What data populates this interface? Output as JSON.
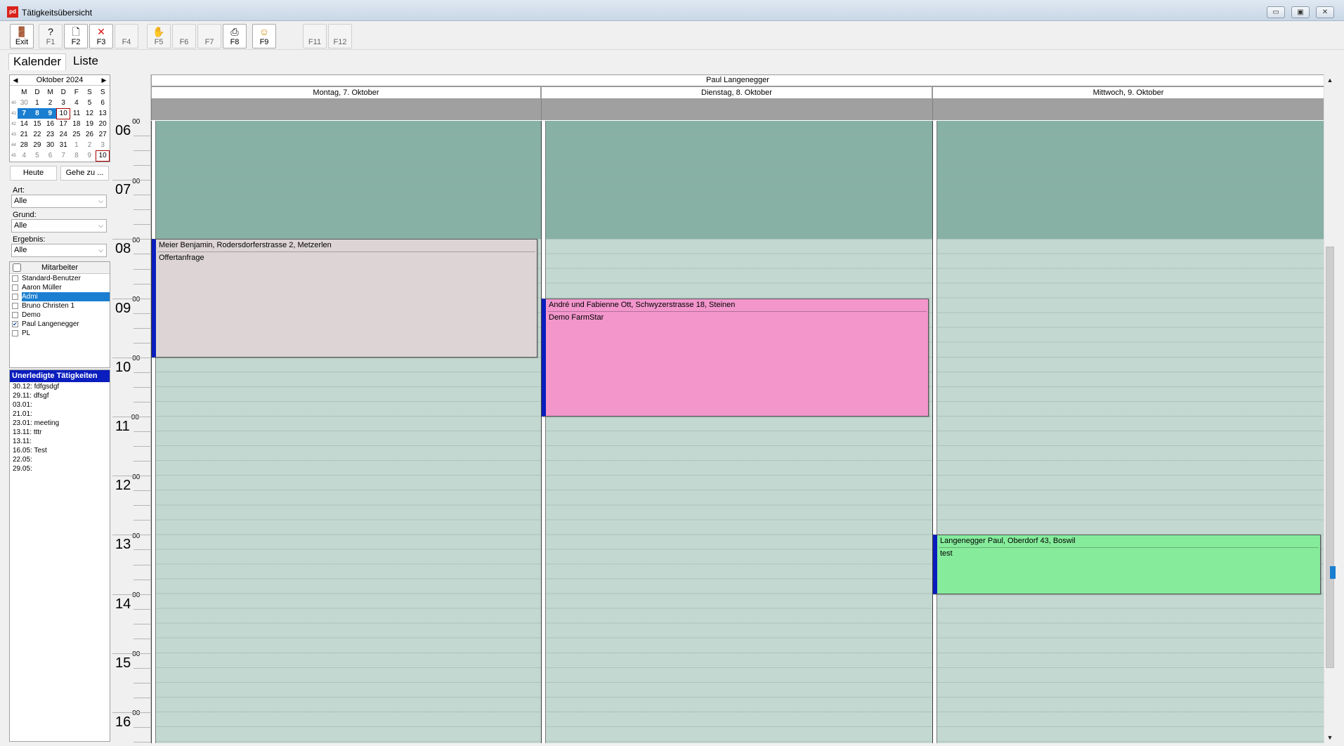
{
  "window": {
    "title": "Tätigkeitsübersicht",
    "app_icon_text": "pd"
  },
  "toolbar": [
    {
      "label": "Exit",
      "icon": "exit-door-icon",
      "glyph": "🚪",
      "active": true
    },
    {
      "label": "F1",
      "icon": "help-icon",
      "glyph": "?",
      "active": false
    },
    {
      "label": "F2",
      "icon": "new-document-icon",
      "glyph": "🗋",
      "active": true
    },
    {
      "label": "F3",
      "icon": "delete-x-icon",
      "glyph": "✕",
      "active": true
    },
    {
      "label": "F4",
      "icon": "",
      "glyph": "",
      "active": false
    },
    {
      "label": "F5",
      "icon": "hand-icon",
      "glyph": "✋",
      "active": false
    },
    {
      "label": "F6",
      "icon": "",
      "glyph": "",
      "active": false
    },
    {
      "label": "F7",
      "icon": "",
      "glyph": "",
      "active": false
    },
    {
      "label": "F8",
      "icon": "print-icon",
      "glyph": "⎙",
      "active": true
    },
    {
      "label": "F9",
      "icon": "calendar-smiley-icon",
      "glyph": "☺",
      "active": true
    },
    {
      "label": "F11",
      "icon": "",
      "glyph": "",
      "active": false
    },
    {
      "label": "F12",
      "icon": "",
      "glyph": "",
      "active": false
    }
  ],
  "view_tabs": {
    "kalender": "Kalender",
    "liste": "Liste"
  },
  "mini_calendar": {
    "month": "Oktober 2024",
    "weekdays": [
      "M",
      "D",
      "M",
      "D",
      "F",
      "S",
      "S"
    ],
    "weeks": [
      {
        "wk": "40",
        "days": [
          "30",
          "1",
          "2",
          "3",
          "4",
          "5",
          "6"
        ]
      },
      {
        "wk": "41",
        "days": [
          "7",
          "8",
          "9",
          "10",
          "11",
          "12",
          "13"
        ]
      },
      {
        "wk": "42",
        "days": [
          "14",
          "15",
          "16",
          "17",
          "18",
          "19",
          "20"
        ]
      },
      {
        "wk": "43",
        "days": [
          "21",
          "22",
          "23",
          "24",
          "25",
          "26",
          "27"
        ]
      },
      {
        "wk": "44",
        "days": [
          "28",
          "29",
          "30",
          "31",
          "1",
          "2",
          "3"
        ]
      },
      {
        "wk": "45",
        "days": [
          "4",
          "5",
          "6",
          "7",
          "8",
          "9",
          "10"
        ]
      }
    ],
    "selected": [
      "7",
      "8",
      "9"
    ],
    "today": "10"
  },
  "nav_buttons": {
    "heute": "Heute",
    "gehe_zu": "Gehe zu ..."
  },
  "filters": {
    "art": {
      "label": "Art:",
      "value": "Alle"
    },
    "grund": {
      "label": "Grund:",
      "value": "Alle"
    },
    "ergebnis": {
      "label": "Ergebnis:",
      "value": "Alle"
    }
  },
  "staff": {
    "header": "Mitarbeiter",
    "items": [
      {
        "name": "Standard-Benutzer",
        "checked": false,
        "highlight": false
      },
      {
        "name": "Aaron Müller",
        "checked": false,
        "highlight": false
      },
      {
        "name": "Admi",
        "checked": false,
        "highlight": true
      },
      {
        "name": "Bruno Christen 1",
        "checked": false,
        "highlight": false
      },
      {
        "name": "Demo",
        "checked": false,
        "highlight": false
      },
      {
        "name": "Paul Langenegger",
        "checked": true,
        "highlight": false
      },
      {
        "name": "PL",
        "checked": false,
        "highlight": false
      }
    ]
  },
  "pending": {
    "header": "Unerledigte Tätigkeiten",
    "items": [
      "30.12: fdfgsdgf",
      "29.11: dfsgf",
      "03.01:",
      "21.01:",
      "23.01: meeting",
      "13.11: tttr",
      "13.11:",
      "16.05: Test",
      "22.05:",
      "29.05:"
    ]
  },
  "calendar": {
    "person": "Paul Langenegger",
    "days": [
      "Montag, 7. Oktober",
      "Dienstag, 8. Oktober",
      "Mittwoch, 9. Oktober"
    ],
    "hours": [
      "06",
      "07",
      "08",
      "09",
      "10",
      "11",
      "12",
      "13",
      "14",
      "15",
      "16"
    ],
    "minute_suffix": "00",
    "colors": {
      "off_hours": "#87b1a5",
      "work_hours": "#c4d8d2",
      "appt_border_accent": "#0a1dbe"
    },
    "appointments": [
      {
        "day": 0,
        "start": "08:00",
        "end": "10:00",
        "title": "Meier Benjamin, Rodersdorferstrasse 2, Metzerlen",
        "note": "Offertanfrage",
        "color": "#ddd5d5"
      },
      {
        "day": 1,
        "start": "09:00",
        "end": "11:00",
        "title": "André und Fabienne Ott, Schwyzerstrasse 18, Steinen",
        "note": "Demo FarmStar",
        "color": "#f296cc"
      },
      {
        "day": 2,
        "start": "13:00",
        "end": "14:00",
        "title": "Langenegger Paul, Oberdorf 43, Boswil",
        "note": "test",
        "color": "#86ec9c"
      }
    ]
  },
  "window_buttons": {
    "min": "▭",
    "max": "▣",
    "close": "✕"
  },
  "scroll": {
    "up": "▲",
    "down": "▼"
  }
}
